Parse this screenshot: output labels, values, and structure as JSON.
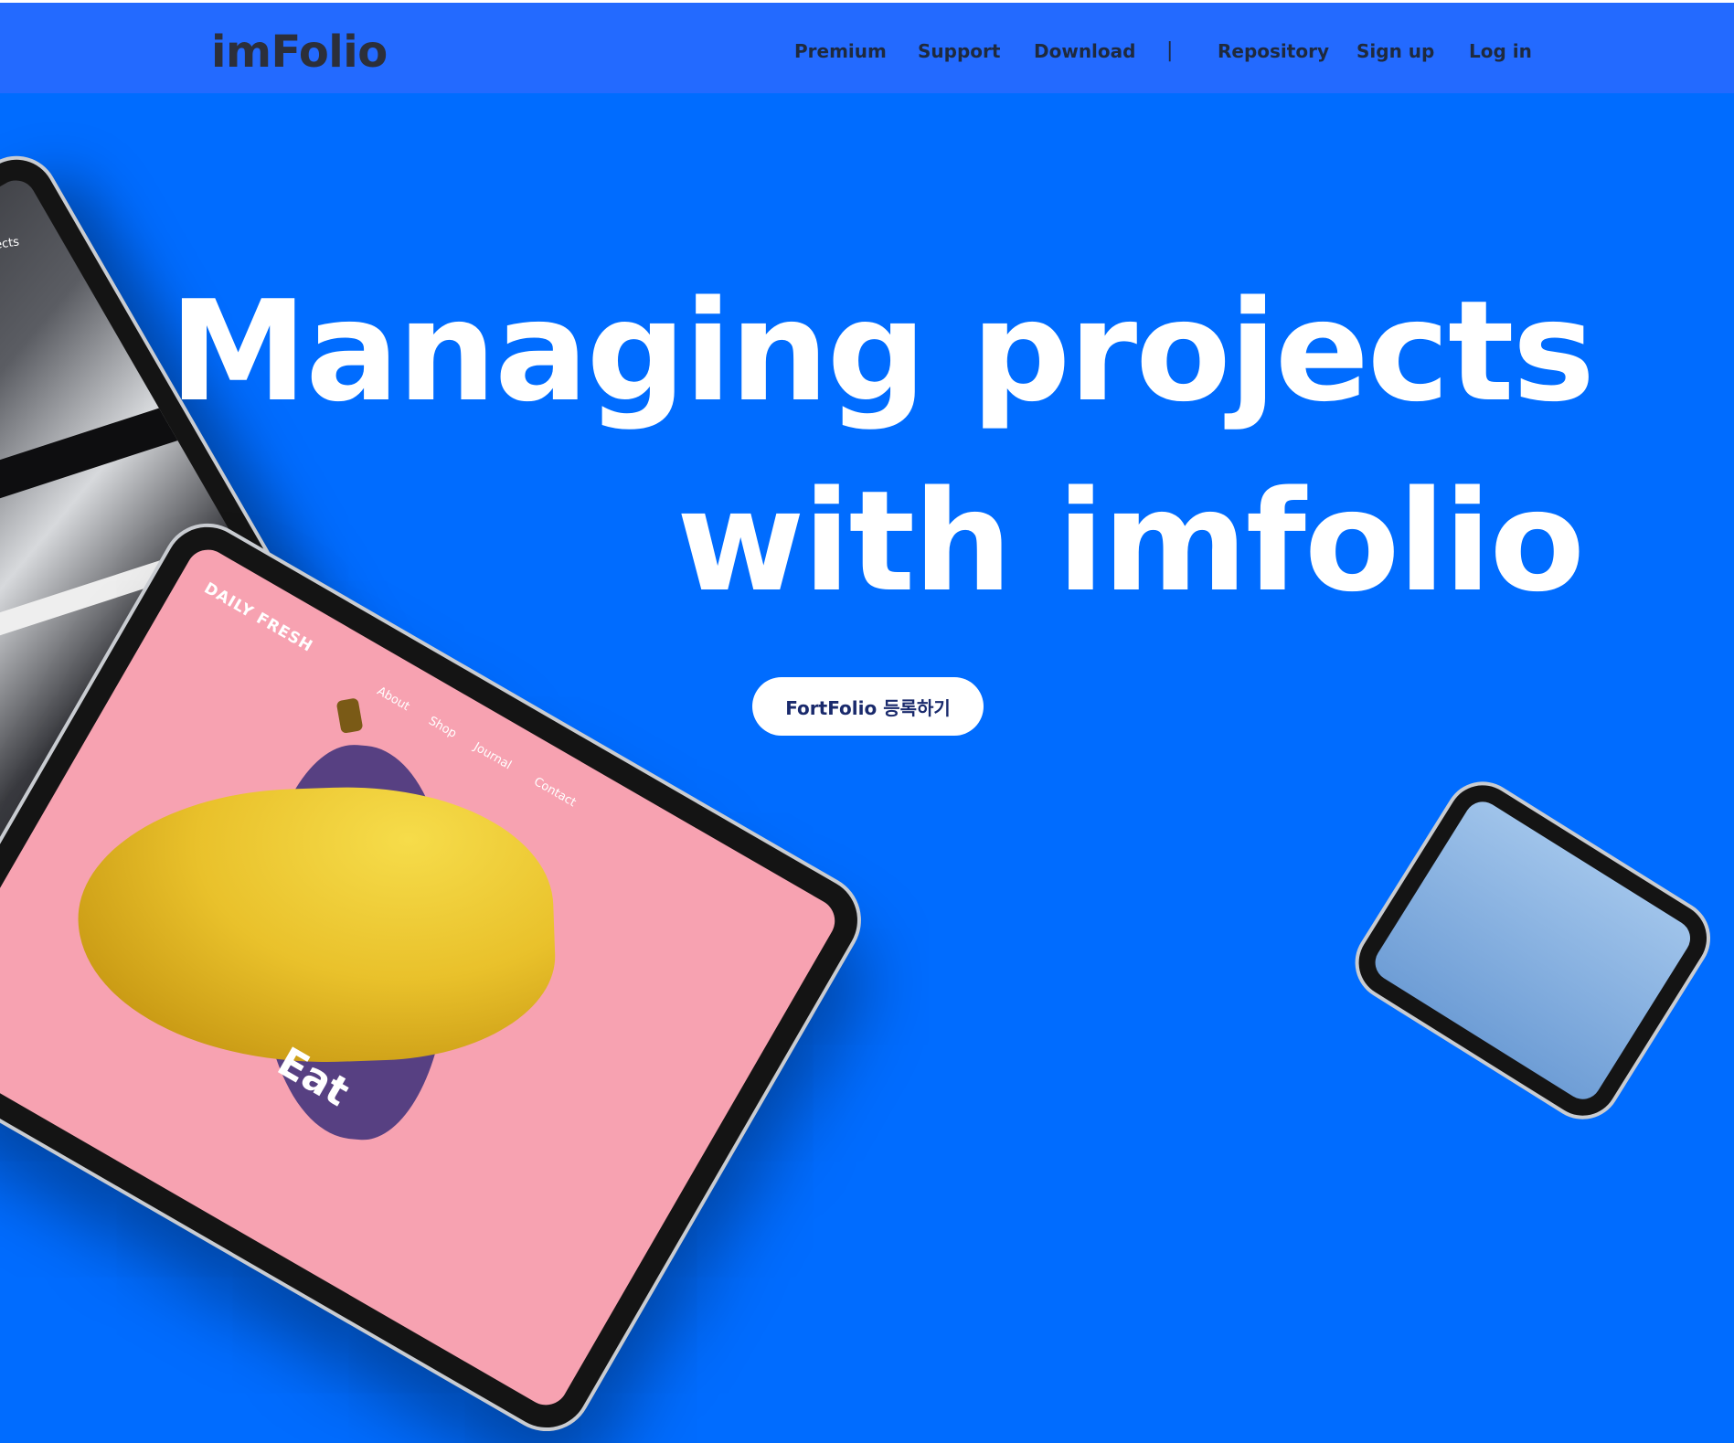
{
  "header": {
    "logo": "imFolio",
    "nav": {
      "premium": "Premium",
      "support": "Support",
      "download": "Download",
      "separator": "|",
      "repository": "Repository",
      "signup": "Sign up",
      "login": "Log in"
    }
  },
  "hero": {
    "line1": "Managing projects",
    "line2": "with imfolio",
    "cta": "FortFolio 등록하기"
  },
  "mockups": {
    "left_tablet_label": "Projects",
    "main_tablet": {
      "brand": "DAILY FRESH",
      "nav": [
        "About",
        "Shop",
        "Journal",
        "Contact"
      ],
      "headline": "Eat"
    }
  },
  "colors": {
    "page_background": "#006cff",
    "header_background": "#236aff",
    "header_text": "#1f2a3d",
    "hero_text": "#ffffff",
    "cta_background": "#ffffff",
    "cta_text": "#1a2a6c"
  }
}
